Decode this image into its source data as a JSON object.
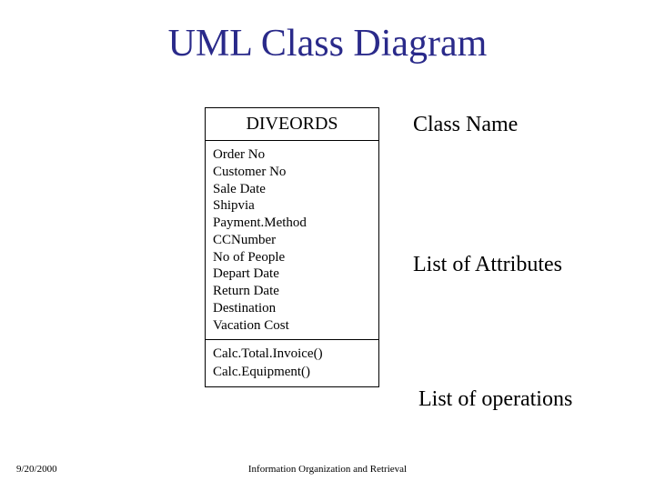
{
  "title": "UML Class Diagram",
  "uml": {
    "class_name": "DIVEORDS",
    "attributes": [
      "Order No",
      "Customer No",
      "Sale Date",
      "Shipvia",
      "Payment.Method",
      "CCNumber",
      "No of People",
      "Depart Date",
      "Return Date",
      "Destination",
      "Vacation Cost"
    ],
    "operations": [
      "Calc.Total.Invoice()",
      "Calc.Equipment()"
    ]
  },
  "labels": {
    "class_name": "Class Name",
    "attributes": "List of Attributes",
    "operations": "List of operations"
  },
  "footer": {
    "date": "9/20/2000",
    "center": "Information Organization and Retrieval"
  }
}
